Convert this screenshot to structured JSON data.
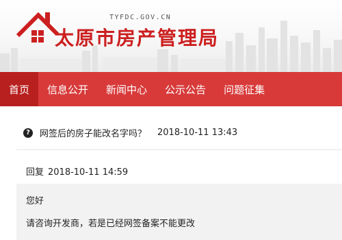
{
  "header": {
    "domain": "TYFDC.GOV.CN",
    "site_title": "太原市房产管理局"
  },
  "nav": {
    "items": [
      {
        "label": "首页",
        "active": true
      },
      {
        "label": "信息公开",
        "active": false
      },
      {
        "label": "新闻中心",
        "active": false
      },
      {
        "label": "公示公告",
        "active": false
      },
      {
        "label": "问题征集",
        "active": false
      }
    ]
  },
  "question": {
    "icon": "question-circle-icon",
    "text": "网签后的房子能改名字吗？",
    "time": "2018-10-11 13:43"
  },
  "reply": {
    "label": "回复",
    "time": "2018-10-11 14:59",
    "greeting": "您好",
    "body": "请咨询开发商，若是已经网签备案不能更改"
  },
  "colors": {
    "brand_red": "#cc1f1f",
    "nav_bg": "#d83a3a",
    "nav_active": "#b81f1f"
  }
}
